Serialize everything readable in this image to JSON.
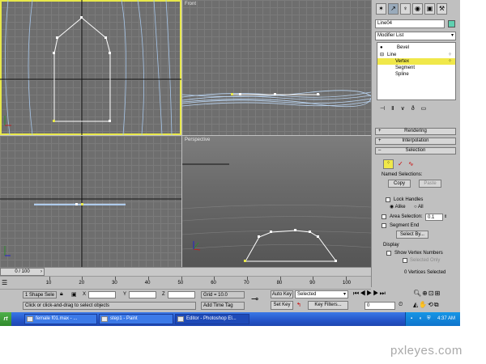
{
  "viewports": {
    "top_left": {
      "label": ""
    },
    "front": {
      "label": "Front"
    },
    "left": {
      "label": ""
    },
    "perspective": {
      "label": "Perspective"
    }
  },
  "command_panel": {
    "object_name": "Line04",
    "modifier_list": "Modifier List",
    "stack": {
      "bevel": "Bevel",
      "line": "Line",
      "vertex": "Vertex",
      "segment": "Segment",
      "spline": "Spline"
    },
    "rollouts": {
      "rendering": "Rendering",
      "interpolation": "Interpolation",
      "selection": "Selection"
    },
    "selection": {
      "named_selections": "Named Selections:",
      "copy": "Copy",
      "paste": "Paste",
      "lock_handles": "Lock Handles",
      "alike": "Alike",
      "all": "All",
      "area_selection": "Area Selection:",
      "area_value": "0.1",
      "segment_end": "Segment End",
      "select_by": "Select By...",
      "display": "Display",
      "show_vertex_numbers": "Show Vertex Numbers",
      "selected_only": "Selected Only",
      "vertices_selected": "0 Vertices Selected"
    }
  },
  "timeline": {
    "frame": "0 / 100",
    "ticks": [
      "10",
      "20",
      "30",
      "40",
      "50",
      "60",
      "70",
      "80",
      "90",
      "100"
    ]
  },
  "status": {
    "selection_count": "1 Shape Sele",
    "x_label": "X",
    "y_label": "Y",
    "z_label": "Z",
    "grid": "Grid = 10.0",
    "prompt": "Click or click-and-drag to select objects",
    "add_time_tag": "Add Time Tag",
    "auto_key": "Auto Key",
    "set_key": "Set Key",
    "key_mode": "Selected",
    "key_filters": "Key Filters...",
    "frame_value": "0"
  },
  "taskbar": {
    "start": "rt",
    "tasks": [
      "female f01.max - ...",
      "step1 - Paint",
      "Editor - Photoshop El..."
    ],
    "time": "4:37 AM"
  },
  "watermark": "pxleyes.com",
  "colors": {
    "active_viewport": "#e8e84a",
    "selection_yellow": "#f0e84a",
    "taskbar": "#2454c8"
  }
}
